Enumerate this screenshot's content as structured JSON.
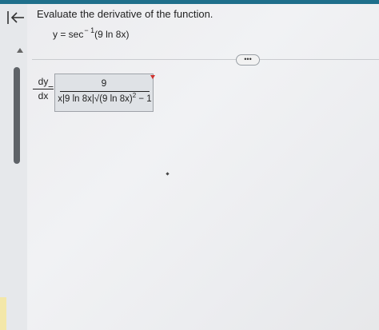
{
  "question": {
    "prompt": "Evaluate the derivative of the function.",
    "function": "y = sec",
    "exponent": "− 1",
    "argument": "(9 ln 8x)"
  },
  "toolbar": {
    "more_label": "•••"
  },
  "answer": {
    "lhs_numerator": "dy",
    "lhs_denominator": "dx",
    "equals": "=",
    "numerator": "9",
    "denominator_prefix": "x|9 ln 8x|√(9 ln 8x)",
    "denominator_power": "2",
    "denominator_suffix": " − 1"
  },
  "colors": {
    "topbar": "#1f6f8b",
    "scrollbar": "#5f6368",
    "answer_box": "#dfe2e6",
    "flag": "#d0312d"
  }
}
